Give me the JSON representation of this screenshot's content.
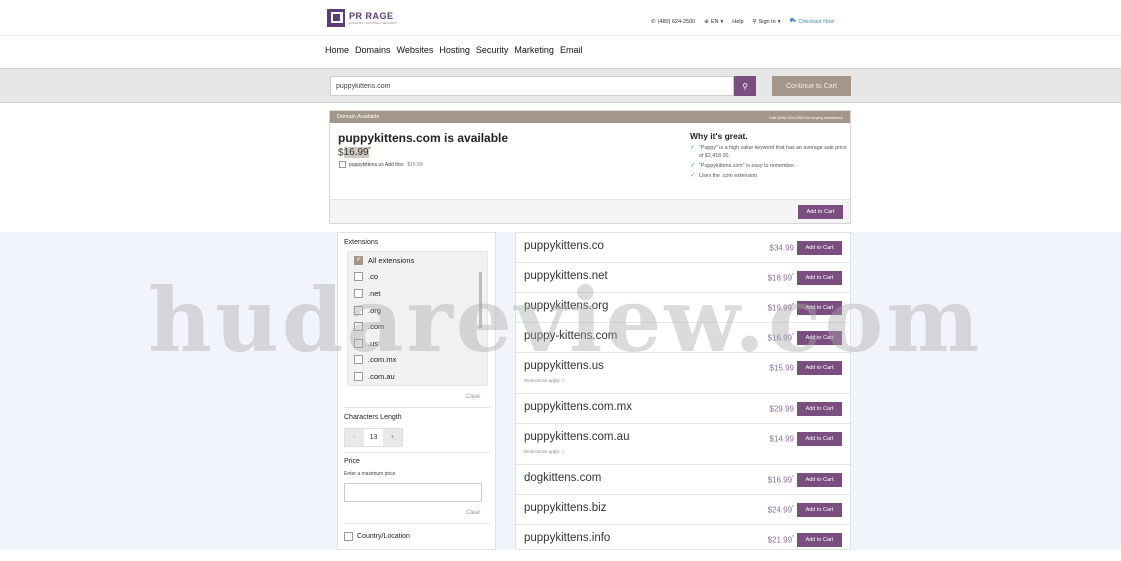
{
  "brand": {
    "name": "PR RAGE",
    "tagline": "DOMAINS • HOSTING • SECURITY"
  },
  "utilities": {
    "phone": "(480) 624-2500",
    "language": "EN",
    "help": "Help",
    "signin": "Sign In",
    "checkout": "Checkout Now"
  },
  "nav": [
    "Home",
    "Domains",
    "Websites",
    "Hosting",
    "Security",
    "Marketing",
    "Email"
  ],
  "search": {
    "value": "puppykittens.com",
    "button_icon": "search-icon",
    "cart_label": "Continue to Cart"
  },
  "available": {
    "header": "Domain Available",
    "call": "Call (480) 624-2500 for buying assistance",
    "domain": "puppykittens.com is available",
    "price_currency": "$",
    "price_amount": "16.99",
    "price_mark": "*",
    "addon_text": "puppykittens.us Add this:",
    "addon_price": "$15.99",
    "why_title": "Why it's great.",
    "why_items": [
      "\"Puppy\" is a high value keyword that has an average sale price of $2,418.00.",
      "\"Puppykittens.com\" is easy to remember.",
      "Uses the .com extension."
    ],
    "add_label": "Add to Cart"
  },
  "filters": {
    "extensions_title": "Extensions",
    "extensions": [
      {
        "label": "All extensions",
        "checked": true
      },
      {
        "label": ".co",
        "checked": false
      },
      {
        "label": ".net",
        "checked": false
      },
      {
        "label": ".org",
        "checked": false
      },
      {
        "label": ".com",
        "checked": false
      },
      {
        "label": ".us",
        "checked": false
      },
      {
        "label": ".com.mx",
        "checked": false
      },
      {
        "label": ".com.au",
        "checked": false
      }
    ],
    "clear": "Clear",
    "length_title": "Characters Length",
    "length_minus": "-",
    "length_value": "13",
    "length_plus": "+",
    "price_title": "Price",
    "price_sub": "Enter a maximum price",
    "country": "Country/Location"
  },
  "results": [
    {
      "domain": "puppykittens.co",
      "price": "$34.99",
      "mark": "",
      "note": ""
    },
    {
      "domain": "puppykittens.net",
      "price": "$18.99",
      "mark": "*",
      "note": ""
    },
    {
      "domain": "puppykittens.org",
      "price": "$19.99",
      "mark": "*",
      "note": ""
    },
    {
      "domain": "puppy-kittens.com",
      "price": "$16.99",
      "mark": "*",
      "note": ""
    },
    {
      "domain": "puppykittens.us",
      "price": "$15.99",
      "mark": "",
      "note": "Restrictions apply"
    },
    {
      "domain": "puppykittens.com.mx",
      "price": "$29.99",
      "mark": "",
      "note": ""
    },
    {
      "domain": "puppykittens.com.au",
      "price": "$14.99",
      "mark": "",
      "note": "Restrictions apply"
    },
    {
      "domain": "dogkittens.com",
      "price": "$16.99",
      "mark": "*",
      "note": ""
    },
    {
      "domain": "puppykittens.biz",
      "price": "$24.99",
      "mark": "*",
      "note": ""
    },
    {
      "domain": "puppykittens.info",
      "price": "$21.99",
      "mark": "*",
      "note": ""
    }
  ],
  "result_button": "Add to Cart",
  "watermark": "hudareview.com",
  "colors": {
    "accent": "#7a4f80",
    "taupe": "#a49688",
    "price": "#8a6f9a"
  }
}
